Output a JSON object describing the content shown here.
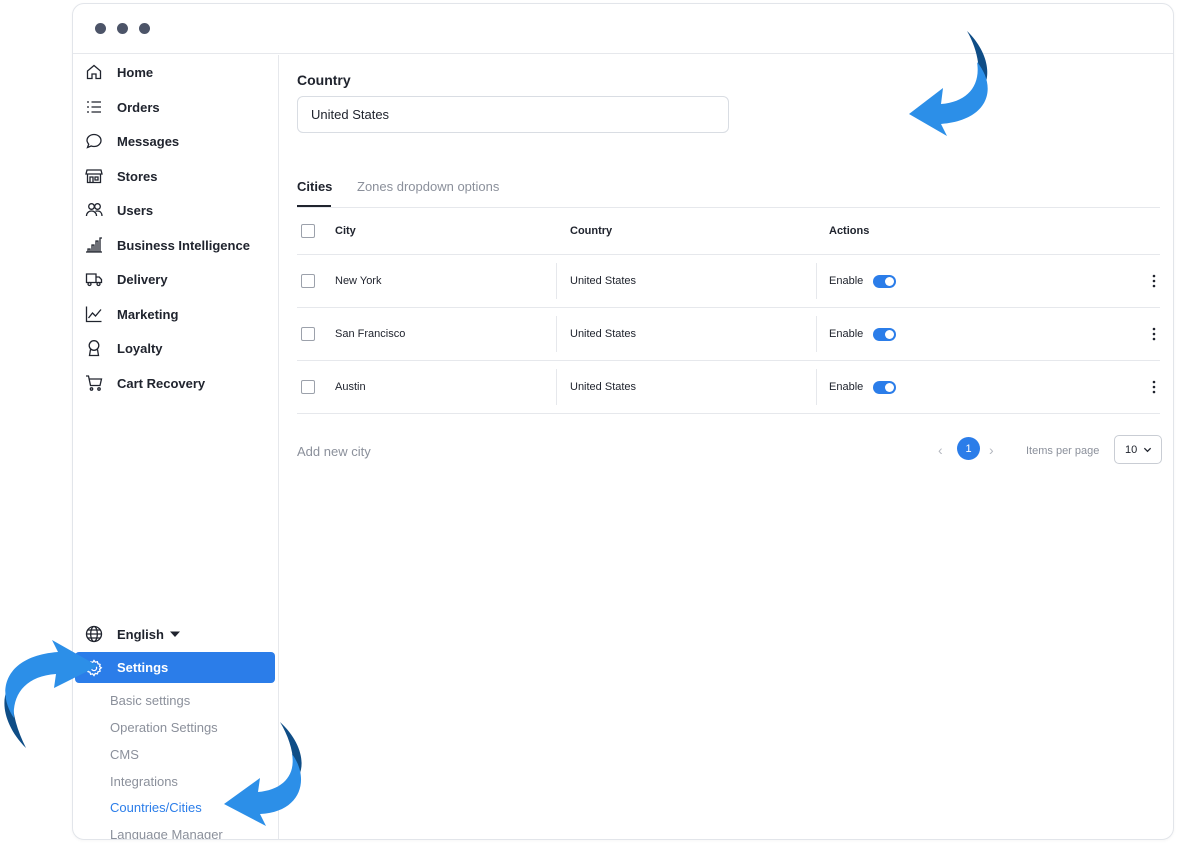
{
  "window": {
    "controls": [
      "close",
      "minimize",
      "maximize"
    ]
  },
  "sidebar": {
    "items": [
      {
        "label": "Home",
        "icon": "home-icon"
      },
      {
        "label": "Orders",
        "icon": "orders-list-icon"
      },
      {
        "label": "Messages",
        "icon": "chat-bubble-icon"
      },
      {
        "label": "Stores",
        "icon": "store-icon"
      },
      {
        "label": "Users",
        "icon": "users-icon"
      },
      {
        "label": "Business Intelligence",
        "icon": "bar-chart-icon"
      },
      {
        "label": "Delivery",
        "icon": "truck-icon"
      },
      {
        "label": "Marketing",
        "icon": "line-chart-icon"
      },
      {
        "label": "Loyalty",
        "icon": "award-icon"
      },
      {
        "label": "Cart Recovery",
        "icon": "cart-icon"
      }
    ],
    "language": {
      "label": "English",
      "icon": "globe-icon"
    },
    "settings": {
      "label": "Settings",
      "icon": "gear-icon"
    },
    "settings_sub": [
      {
        "label": "Basic settings"
      },
      {
        "label": "Operation Settings"
      },
      {
        "label": "CMS"
      },
      {
        "label": "Integrations"
      },
      {
        "label": "Countries/Cities",
        "active": true
      },
      {
        "label": "Language Manager"
      }
    ]
  },
  "main": {
    "country_label": "Country",
    "country_value": "United States",
    "tabs": [
      {
        "label": "Cities",
        "active": true
      },
      {
        "label": "Zones dropdown options",
        "active": false
      }
    ],
    "table": {
      "columns": [
        "City",
        "Country",
        "Actions"
      ],
      "rows": [
        {
          "city": "New York",
          "country": "United States",
          "action": "Enable",
          "enabled": true
        },
        {
          "city": "San Francisco",
          "country": "United States",
          "action": "Enable",
          "enabled": true
        },
        {
          "city": "Austin",
          "country": "United States",
          "action": "Enable",
          "enabled": true
        }
      ]
    },
    "add_city": "Add new city",
    "pagination": {
      "current_page": "1",
      "items_per_page_label": "Items per page",
      "items_per_page_value": "10"
    }
  },
  "colors": {
    "accent": "#2b7de9",
    "arrow": "#2c8fe8",
    "arrow_dark": "#0f4d86"
  }
}
